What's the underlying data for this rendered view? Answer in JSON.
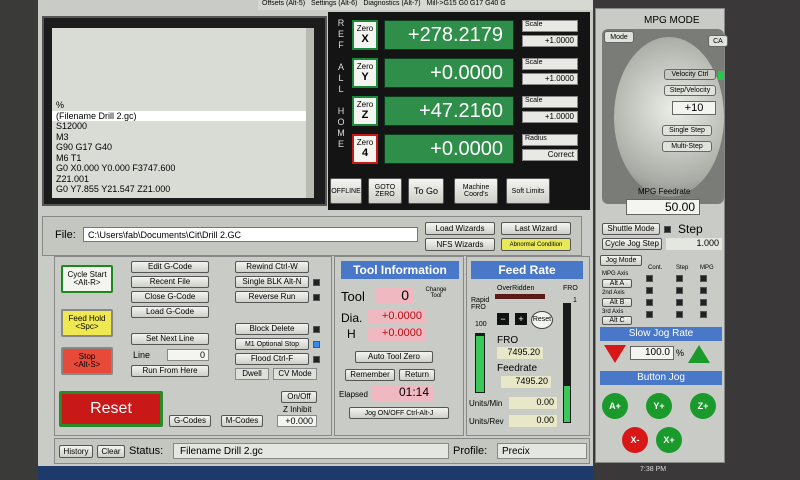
{
  "tabs": {
    "offsets": "Offsets (Alt-5)",
    "settings": "Settings (Alt-6)",
    "diagnostics": "Diagnostics (Alt-7)",
    "gcode_state": "Mill->G15  G0 G17 G40 G"
  },
  "gcode_list": [
    "%",
    "(Filename Drill 2.gc)",
    "S12000",
    "M3",
    "G90 G17 G40",
    "M6 T1",
    "G0 X0.000 Y0.000 F3747.600",
    "Z21.001",
    "G0 Y7.855 Y21.547 Z21.000"
  ],
  "ref_all_home": "REF ALL HOME",
  "axes": [
    {
      "zero": "Zero",
      "letter": "X",
      "value": "+278.2179",
      "scale_label": "Scale",
      "scale": "+1.0000"
    },
    {
      "zero": "Zero",
      "letter": "Y",
      "value": "+0.0000",
      "scale_label": "Scale",
      "scale": "+1.0000"
    },
    {
      "zero": "Zero",
      "letter": "Z",
      "value": "+47.2160",
      "scale_label": "Scale",
      "scale": "+1.0000"
    },
    {
      "zero": "Zero",
      "letter": "4",
      "value": "+0.0000",
      "scale_label": "Radius",
      "scale": "Correct"
    }
  ],
  "dro_buttons": {
    "offline": "OFFLINE",
    "goto_zero": "GOTO ZERO",
    "to_go": "To Go",
    "machine": "Machine Coord's",
    "soft": "Soft Limits"
  },
  "file": {
    "label": "File:",
    "path": "C:\\Users\\fab\\Documents\\Cit\\Drill 2.GC"
  },
  "wizards": {
    "load": "Load Wizards",
    "last": "Last Wizard",
    "nfs": "NFS Wizards",
    "abnormal": "Abnormal Condition"
  },
  "run": {
    "cycle_start": "Cycle Start",
    "cycle_start_key": "<Alt-R>",
    "feed_hold": "Feed Hold",
    "feed_hold_key": "<Spc>",
    "stop": "Stop",
    "stop_key": "<Alt-S>",
    "reset": "Reset"
  },
  "file_btns": {
    "edit": "Edit G-Code",
    "recent": "Recent File",
    "close": "Close G-Code",
    "load": "Load G-Code",
    "set_next": "Set Next Line",
    "line": "Line",
    "line_val": "0",
    "run_from": "Run From Here"
  },
  "run_btns": {
    "rewind": "Rewind Ctrl-W",
    "single": "Single BLK Alt-N",
    "reverse": "Reverse Run",
    "block_delete": "Block Delete",
    "m1": "M1 Optional Stop",
    "flood": "Flood Ctrl-F",
    "dwell": "Dwell",
    "cv": "CV Mode"
  },
  "onoff": {
    "onoff": "On/Off",
    "z_inhibit": "Z Inhibit",
    "z_val": "+0.000",
    "gcodes": "G-Codes",
    "mcodes": "M-Codes"
  },
  "tool": {
    "title": "Tool Information",
    "tool_lbl": "Tool",
    "tool_val": "0",
    "change": "Change Tool",
    "dia_lbl": "Dia.",
    "dia_val": "+0.0000",
    "h_lbl": "H",
    "h_val": "+0.0000",
    "auto_zero": "Auto Tool Zero",
    "remember": "Remember",
    "return": "Return",
    "elapsed_lbl": "Elapsed",
    "elapsed": "01:14",
    "jog_onoff": "Jog ON/OFF Ctrl-Alt-J"
  },
  "feed": {
    "title": "Feed Rate",
    "overridden": "OverRidden",
    "fro": "FRO",
    "rapid": "Rapid FRO",
    "rapid_val": "100",
    "fro_pct": "1",
    "fro_lbl": "FRO",
    "fro_val": "7495.20",
    "feedrate_lbl": "Feedrate",
    "feedrate_val": "7495.20",
    "units_min": "Units/Min",
    "units_min_val": "0.00",
    "units_rev": "Units/Rev",
    "units_rev_val": "0.00",
    "reset": "Reset"
  },
  "status": {
    "history": "History",
    "clear": "Clear",
    "label": "Status:",
    "text": "Filename Drill 2.gc",
    "profile_lbl": "Profile:",
    "profile": "Precix"
  },
  "mpg": {
    "title": "MPG MODE",
    "mode": "Mode",
    "cal": "CA",
    "velocity": "Velocity Ctrl",
    "step_velocity": "Step/Velocity",
    "step_val": "+10",
    "single_step": "Single Step",
    "multi_step": "Multi-Step",
    "feedrate_lbl": "MPG Feedrate",
    "feedrate": "50.00"
  },
  "jog": {
    "shuttle": "Shuttle Mode",
    "step": "Step",
    "cycle_step": "Cycle Jog Step",
    "cycle_val": "1.000",
    "jog_mode": "Jog Mode",
    "cont": "Cont.",
    "stp": "Step",
    "mpg": "MPG",
    "mpg_axis": "MPG Axis",
    "alt_a": "Alt A",
    "axis2": "2nd Axis",
    "alt_b": "Alt B",
    "axis3": "3rd Axis",
    "alt_c": "Alt C",
    "slow_label": "Slow Jog Rate",
    "slow_val": "100.0",
    "pct": "%",
    "button_jog": "Button Jog",
    "a_plus": "A+",
    "y_plus": "Y+",
    "z_plus": "Z+",
    "x_minus": "X-",
    "x_plus": "X+",
    "clock": "7:38 PM"
  },
  "colors": {
    "dro_green": "#2f8f4a",
    "panel_gray": "#c9ccc6",
    "blue_title": "#4a78c8",
    "reset_red": "#c81818"
  }
}
